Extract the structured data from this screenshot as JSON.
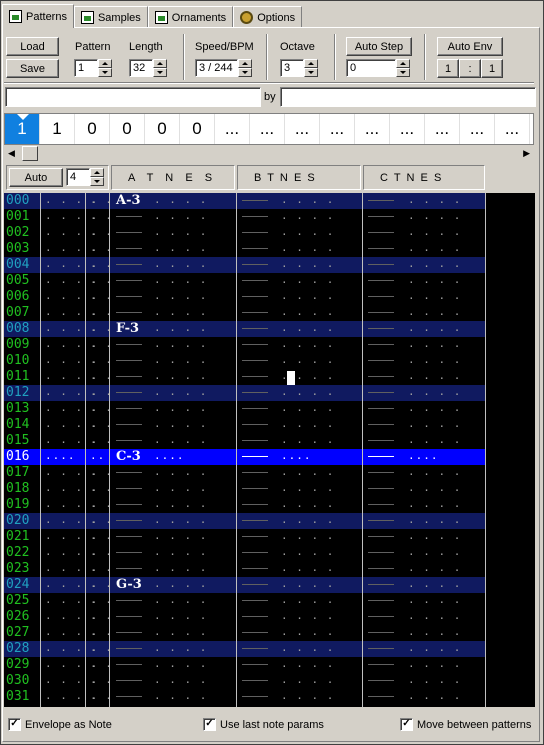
{
  "tabs": [
    {
      "label": "Patterns",
      "icon": "pattern-icon",
      "active": true
    },
    {
      "label": "Samples",
      "icon": "sample-icon",
      "active": false
    },
    {
      "label": "Ornaments",
      "icon": "ornament-icon",
      "active": false
    },
    {
      "label": "Options",
      "icon": "options-gear-icon",
      "active": false
    }
  ],
  "toolbar": {
    "load_label": "Load",
    "save_label": "Save",
    "pattern_label": "Pattern",
    "pattern_value": "1",
    "length_label": "Length",
    "length_value": "32",
    "speed_label": "Speed/BPM",
    "speed_value": "3 / 244",
    "octave_label": "Octave",
    "octave_value": "3",
    "autostep_label": "Auto Step",
    "autostep_value": "0",
    "autoenv_label": "Auto Env",
    "autoenv_a": "1",
    "autoenv_sep": ":",
    "autoenv_b": "1"
  },
  "title_row": {
    "title_value": "",
    "by_label": "by",
    "author_value": ""
  },
  "order_list": [
    "1",
    "1",
    "0",
    "0",
    "0",
    "0",
    "...",
    "...",
    "...",
    "...",
    "...",
    "...",
    "...",
    "...",
    "...",
    "..."
  ],
  "channel_header": {
    "auto_label": "Auto",
    "auto_value": "4",
    "a": "A  T  N  E  S",
    "b": "B  T  N  E  S",
    "c": "C  T  N  E  S"
  },
  "rows": [
    {
      "num": "000",
      "a_note": "A-3"
    },
    {
      "num": "001",
      "a_note": ""
    },
    {
      "num": "002",
      "a_note": ""
    },
    {
      "num": "003",
      "a_note": ""
    },
    {
      "num": "004",
      "a_note": ""
    },
    {
      "num": "005",
      "a_note": ""
    },
    {
      "num": "006",
      "a_note": ""
    },
    {
      "num": "007",
      "a_note": ""
    },
    {
      "num": "008",
      "a_note": "F-3"
    },
    {
      "num": "009",
      "a_note": ""
    },
    {
      "num": "010",
      "a_note": ""
    },
    {
      "num": "011",
      "a_note": ""
    },
    {
      "num": "012",
      "a_note": ""
    },
    {
      "num": "013",
      "a_note": ""
    },
    {
      "num": "014",
      "a_note": ""
    },
    {
      "num": "015",
      "a_note": ""
    },
    {
      "num": "016",
      "a_note": "C-3"
    },
    {
      "num": "017",
      "a_note": ""
    },
    {
      "num": "018",
      "a_note": ""
    },
    {
      "num": "019",
      "a_note": ""
    },
    {
      "num": "020",
      "a_note": ""
    },
    {
      "num": "021",
      "a_note": ""
    },
    {
      "num": "022",
      "a_note": ""
    },
    {
      "num": "023",
      "a_note": ""
    },
    {
      "num": "024",
      "a_note": "G-3"
    },
    {
      "num": "025",
      "a_note": ""
    },
    {
      "num": "026",
      "a_note": ""
    },
    {
      "num": "027",
      "a_note": ""
    },
    {
      "num": "028",
      "a_note": ""
    },
    {
      "num": "029",
      "a_note": ""
    },
    {
      "num": "030",
      "a_note": ""
    },
    {
      "num": "031",
      "a_note": ""
    }
  ],
  "current_row": "016",
  "checkboxes": [
    {
      "label": "Envelope as Note",
      "checked": true
    },
    {
      "label": "Use last note params",
      "checked": true
    },
    {
      "label": "Move between patterns",
      "checked": true
    }
  ],
  "colors": {
    "row_number": "#20c020",
    "highlight_row": "#101a60",
    "current_row": "#0000ff",
    "order_selected": "#1080e0"
  }
}
